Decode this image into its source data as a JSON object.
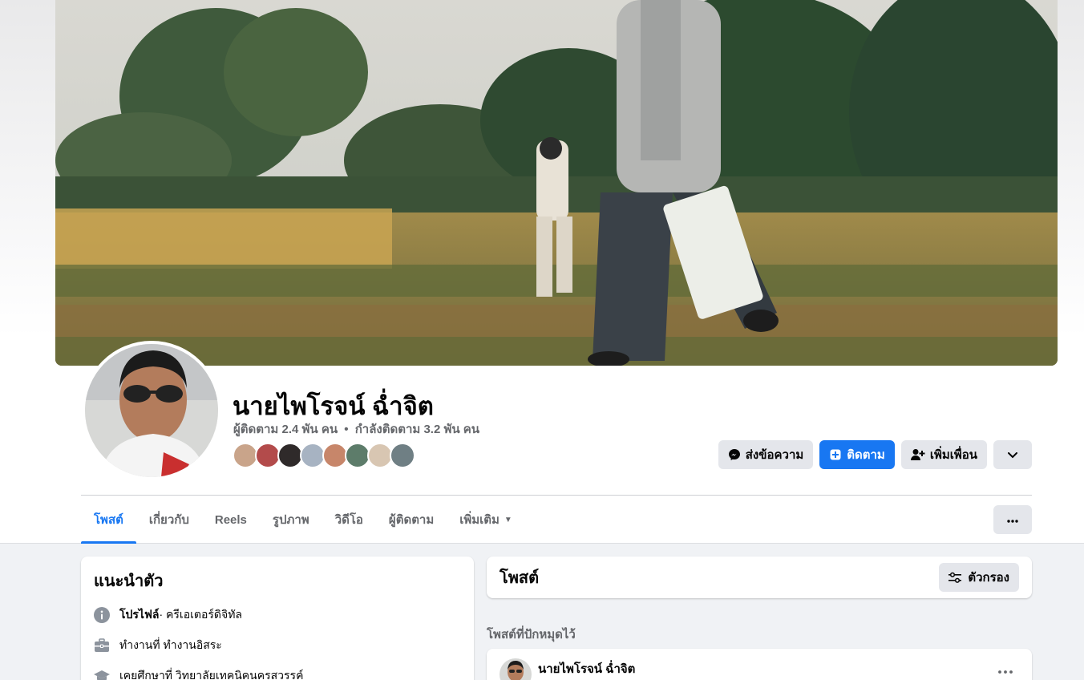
{
  "profile": {
    "name": "นายไพโรจน์ ฉ่ำจิต",
    "followers": "ผู้ติดตาม 2.4 พัน คน",
    "separator": "•",
    "following": "กำลังติดตาม 3.2 พัน คน"
  },
  "actions": {
    "message_label": "ส่งข้อความ",
    "follow_label": "ติดตาม",
    "add_friend_label": "เพิ่มเพื่อน",
    "message_icon": "messenger-icon",
    "follow_icon": "follow-icon",
    "add_friend_icon": "add-friend-icon",
    "dropdown_icon": "chevron-down-icon"
  },
  "tabs": [
    {
      "label": "โพสต์",
      "active": true
    },
    {
      "label": "เกี่ยวกับ"
    },
    {
      "label": "Reels"
    },
    {
      "label": "รูปภาพ"
    },
    {
      "label": "วิดีโอ"
    },
    {
      "label": "ผู้ติดตาม"
    },
    {
      "label": "เพิ่มเติม",
      "caret": "▼"
    }
  ],
  "intro": {
    "title": "แนะนำตัว",
    "rows": [
      {
        "icon": "info-icon",
        "bold": "โปรไฟล์",
        "text": " · ครีเอเตอร์ดิจิทัล"
      },
      {
        "icon": "briefcase-icon",
        "text": "ทำงานที่ ทำงานอิสระ"
      },
      {
        "icon": "graduation-cap-icon",
        "text": "เคยศึกษาที่ วิทยาลัยเทคนิคนครสวรรค์"
      }
    ]
  },
  "posts": {
    "title": "โพสต์",
    "filter_label": "ตัวกรอง",
    "filter_icon": "filter-sliders-icon",
    "pinned_label": "โพสต์ที่ปักหมุดไว้",
    "pinned_post": {
      "author": "นายไพโรจน์ ฉ่ำจิต"
    }
  },
  "colors": {
    "accent": "#1877f2",
    "background": "#f0f2f5",
    "button_gray": "#e4e6eb",
    "text_secondary": "#65676b"
  }
}
